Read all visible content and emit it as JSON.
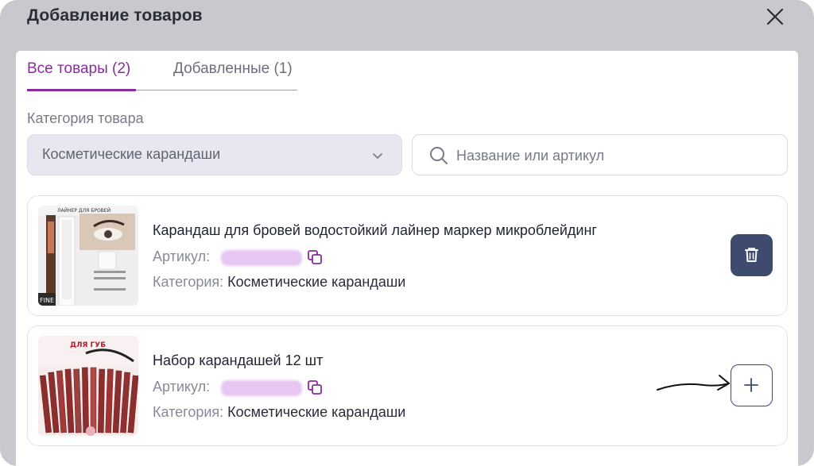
{
  "dialog": {
    "title": "Добавление товаров"
  },
  "tabs": [
    {
      "label": "Все товары (2)",
      "active": true
    },
    {
      "label": "Добавленные (1)",
      "active": false
    }
  ],
  "filters": {
    "category_label": "Категория товара",
    "category_value": "Косметические карандаши",
    "search_placeholder": "Название или артикул"
  },
  "products": [
    {
      "name": "Карандаш для бровей водостойкий лайнер маркер микроблейдинг",
      "sku_label": "Артикул:",
      "category_label": "Категория:",
      "category": "Косметические карандаши",
      "action": "delete",
      "icon": "trash-icon"
    },
    {
      "name": "Набор карандашей 12 шт",
      "sku_label": "Артикул:",
      "category_label": "Категория:",
      "category": "Косметические карандаши",
      "action": "add",
      "icon": "plus-icon"
    }
  ],
  "thumbs": {
    "brow_top": "ЛАЙНЕР ДЛЯ БРОВЕЙ",
    "brow_brand": "FINE",
    "lip_top": "ДЛЯ ГУБ"
  },
  "colors": {
    "accent": "#8a2a9e",
    "button_dark": "#3e4a6e",
    "overlay": "#c8c8ce"
  }
}
